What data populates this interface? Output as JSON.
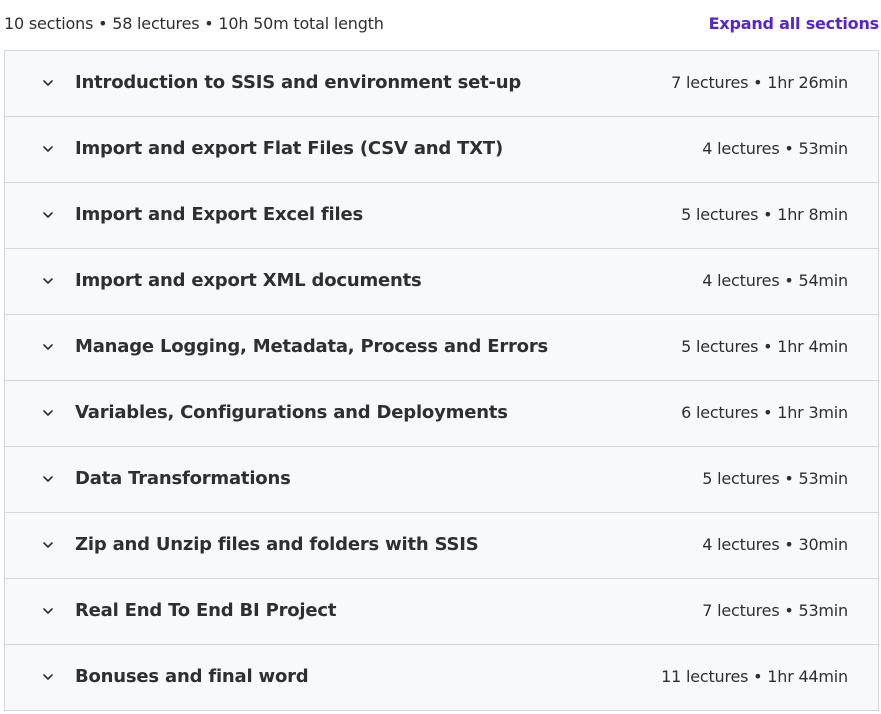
{
  "header": {
    "summary": "10 sections • 58 lectures • 10h 50m total length",
    "expand_all_label": "Expand all sections"
  },
  "colors": {
    "accent": "#5624d0",
    "row_background": "#f7f9fa",
    "border": "#d1d7dc",
    "text": "#2d2f31"
  },
  "sections": [
    {
      "title": "Introduction to SSIS and environment set-up",
      "meta": "7 lectures • 1hr 26min",
      "icon": "chevron-down-icon"
    },
    {
      "title": "Import and export Flat Files (CSV and TXT)",
      "meta": "4 lectures • 53min",
      "icon": "chevron-down-icon"
    },
    {
      "title": "Import and Export Excel files",
      "meta": "5 lectures • 1hr 8min",
      "icon": "chevron-down-icon"
    },
    {
      "title": "Import and export XML documents",
      "meta": "4 lectures • 54min",
      "icon": "chevron-down-icon"
    },
    {
      "title": "Manage Logging, Metadata, Process and Errors",
      "meta": "5 lectures • 1hr 4min",
      "icon": "chevron-down-icon"
    },
    {
      "title": "Variables, Configurations and Deployments",
      "meta": "6 lectures • 1hr 3min",
      "icon": "chevron-down-icon"
    },
    {
      "title": "Data Transformations",
      "meta": "5 lectures • 53min",
      "icon": "chevron-down-icon"
    },
    {
      "title": "Zip and Unzip files and folders with SSIS",
      "meta": "4 lectures • 30min",
      "icon": "chevron-down-icon"
    },
    {
      "title": "Real End To End BI Project",
      "meta": "7 lectures • 53min",
      "icon": "chevron-down-icon"
    },
    {
      "title": "Bonuses and final word",
      "meta": "11 lectures • 1hr 44min",
      "icon": "chevron-down-icon"
    }
  ]
}
